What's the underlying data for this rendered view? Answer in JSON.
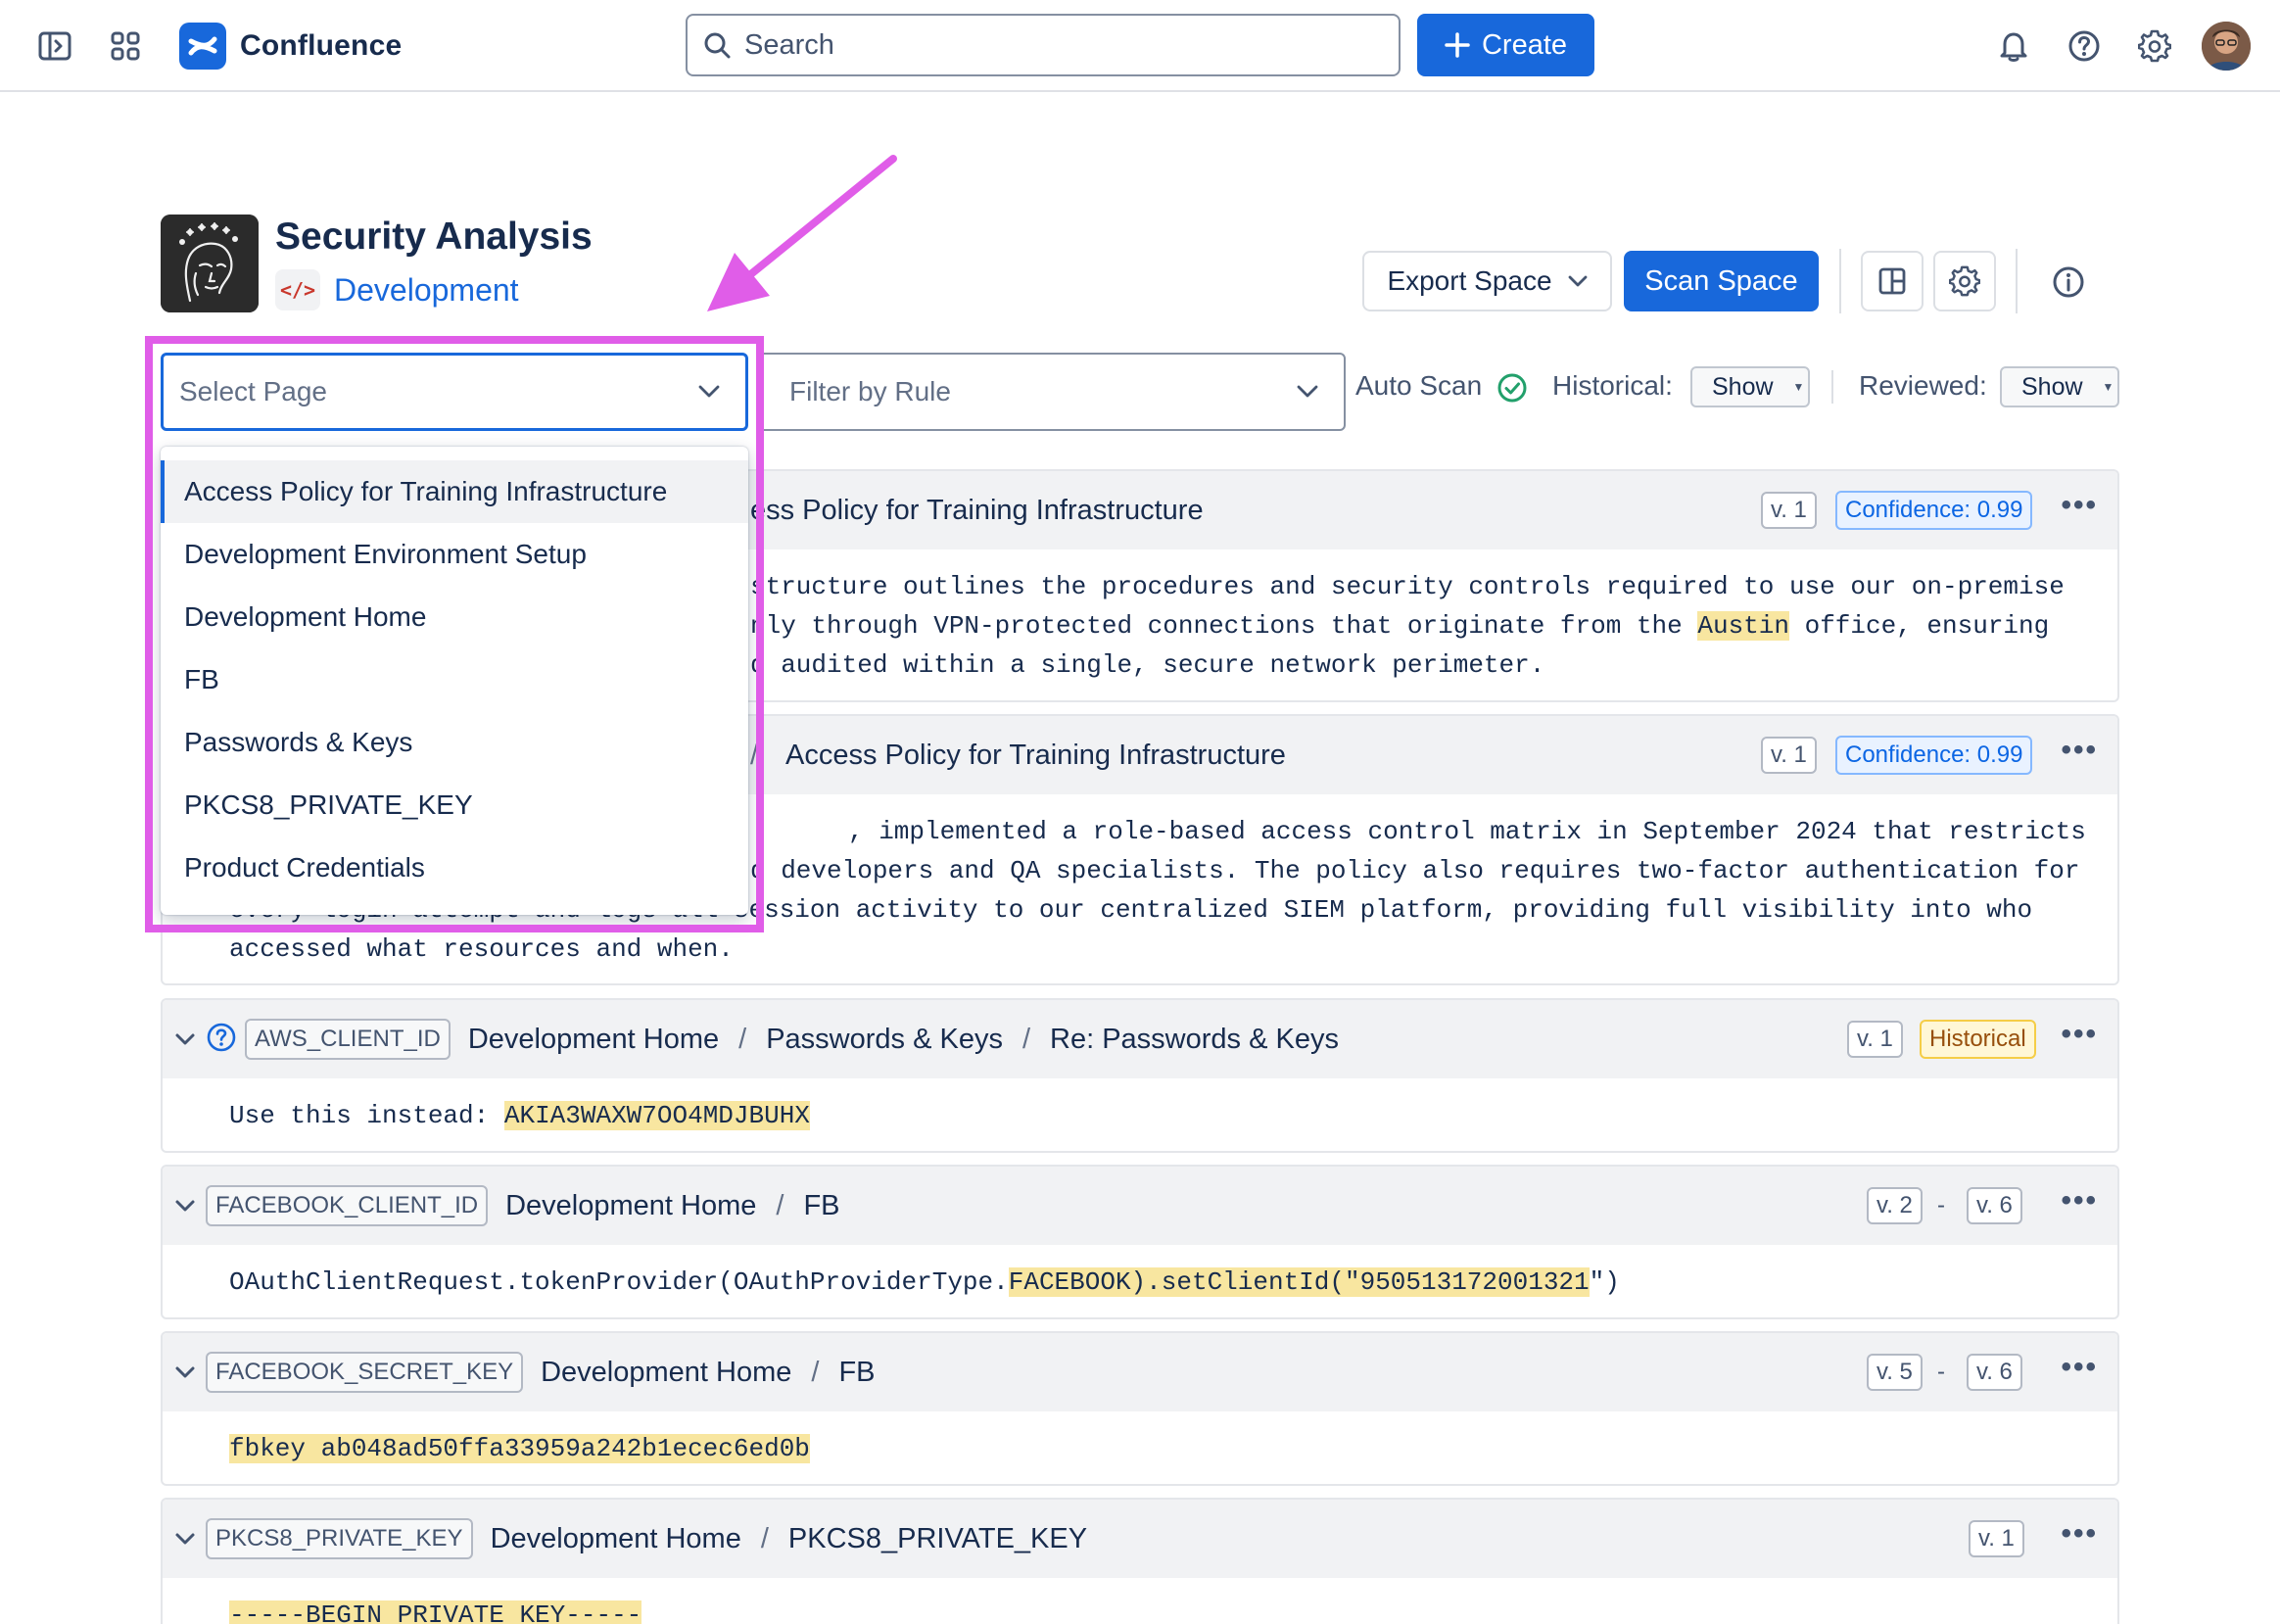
{
  "nav": {
    "app_name": "Confluence",
    "search_placeholder": "Search",
    "create_label": "Create",
    "icons": [
      "sidebar-toggle-icon",
      "app-switcher-icon",
      "bell-icon",
      "help-icon",
      "settings-icon"
    ]
  },
  "space": {
    "title": "Security Analysis",
    "link_label": "Development",
    "code_glyph": "</>"
  },
  "toolbar": {
    "export_label": "Export Space",
    "scan_label": "Scan Space"
  },
  "filters": {
    "page_select_placeholder": "Select Page",
    "rule_filter_placeholder": "Filter by Rule",
    "auto_scan_label": "Auto Scan",
    "historical_label": "Historical:",
    "historical_value": "Show",
    "reviewed_label": "Reviewed:",
    "reviewed_value": "Show"
  },
  "page_menu": {
    "options": [
      "Access Policy for Training Infrastructure",
      "Development Environment Setup",
      "Development Home",
      "FB",
      "Passwords & Keys",
      "PKCS8_PRIVATE_KEY",
      "Product Credentials"
    ],
    "highlighted_index": 0
  },
  "results": [
    {
      "title_visible": "ess Policy for Training Infrastructure",
      "version": "v. 1",
      "badge": "Confidence: 0.99",
      "lines": [
        [
          "structure outlines the procedures and security controls required to use our on-premise"
        ],
        [
          "nly through VPN-protected connections that originate from the ",
          "Austin",
          " office, ensuring"
        ],
        [
          "d audited within a single, secure network perimeter."
        ]
      ]
    },
    {
      "sep_visible": "/",
      "title_visible": "Access Policy for Training Infrastructure",
      "version": "v. 1",
      "badge": "Confidence: 0.99",
      "lines": [
        [
          ", implemented a role-based access control matrix in September 2024 that restricts"
        ],
        [
          "d developers and QA specialists. The policy also requires two-factor authentication for"
        ],
        [
          "every login attempt and logs all session activity to our centralized SIEM platform, providing full visibility into who"
        ],
        [
          "accessed what resources and when."
        ]
      ]
    },
    {
      "rule": "AWS_CLIENT_ID",
      "crumbs": [
        "Development Home",
        "Passwords & Keys",
        "Re: Passwords & Keys"
      ],
      "version": "v. 1",
      "badge": "Historical",
      "line_prefix": "Use this instead: ",
      "line_secret": "AKIA3WAXW7OO4MDJBUHX"
    },
    {
      "rule": "FACEBOOK_CLIENT_ID",
      "crumbs": [
        "Development Home",
        "FB"
      ],
      "version_from": "v. 2",
      "version_to": "v. 6",
      "dash": "-",
      "line_prefix": "OAuthClientRequest.tokenProvider(OAuthProviderType.",
      "line_secret": "FACEBOOK).setClientId(\"950513172001321",
      "line_suffix": "\")"
    },
    {
      "rule": "FACEBOOK_SECRET_KEY",
      "crumbs": [
        "Development Home",
        "FB"
      ],
      "version_from": "v. 5",
      "version_to": "v. 6",
      "dash": "-",
      "line_secret": "fbkey ab048ad50ffa33959a242b1ecec6ed0b"
    },
    {
      "rule": "PKCS8_PRIVATE_KEY",
      "crumbs": [
        "Development Home",
        "PKCS8_PRIVATE_KEY"
      ],
      "version": "v. 1",
      "line_secret": "-----BEGIN PRIVATE KEY-----"
    }
  ],
  "more_glyph": "•••",
  "colors": {
    "brand_blue": "#1868db",
    "annotation_magenta": "#e05de8",
    "secret_highlight": "#f8e6a0",
    "historical_bg": "#fff7d6",
    "confidence_bg": "#e9f2ff",
    "success_green": "#22a06b"
  }
}
